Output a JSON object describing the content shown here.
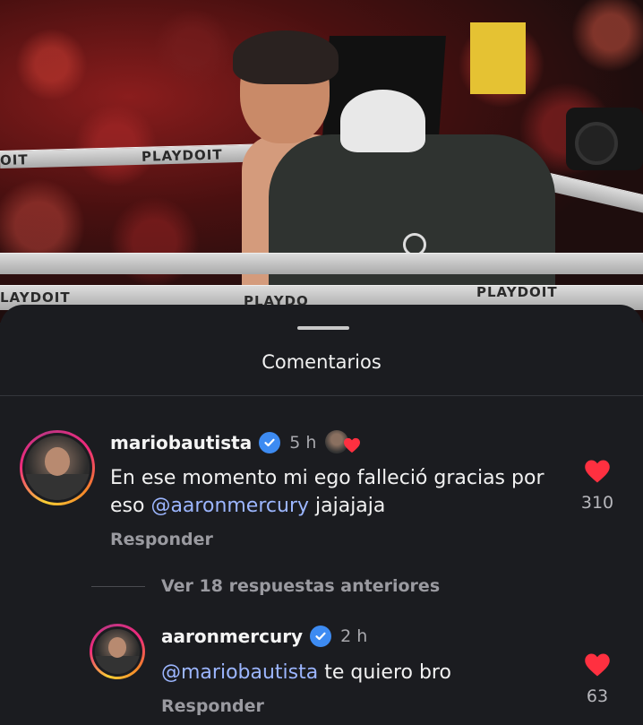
{
  "video": {
    "rope_brand": "PLAYDOIT",
    "rope_fragment_left": "OIT",
    "rope_fragment_bottom_left": "LAYDOIT",
    "rope_fragment_bottom_mid": "PLAYDO"
  },
  "sheet": {
    "title": "Comentarios"
  },
  "comments": [
    {
      "username": "mariobautista",
      "time": "5 h",
      "text_before": "En ese momento mi ego falleció gracias por eso ",
      "mention": "@aaronmercury",
      "text_after": " jajajaja",
      "likes": "310",
      "reply_label": "Responder"
    }
  ],
  "view_replies": "Ver 18 respuestas anteriores",
  "replies": [
    {
      "username": "aaronmercury",
      "time": "2 h",
      "mention": "@mariobautista",
      "text_after": " te quiero bro",
      "likes": "63",
      "reply_label": "Responder"
    }
  ],
  "colors": {
    "sheet_bg": "#1b1c20",
    "mention": "#9cb6ff",
    "verified": "#3d8bf2",
    "heart": "#ff3040"
  }
}
